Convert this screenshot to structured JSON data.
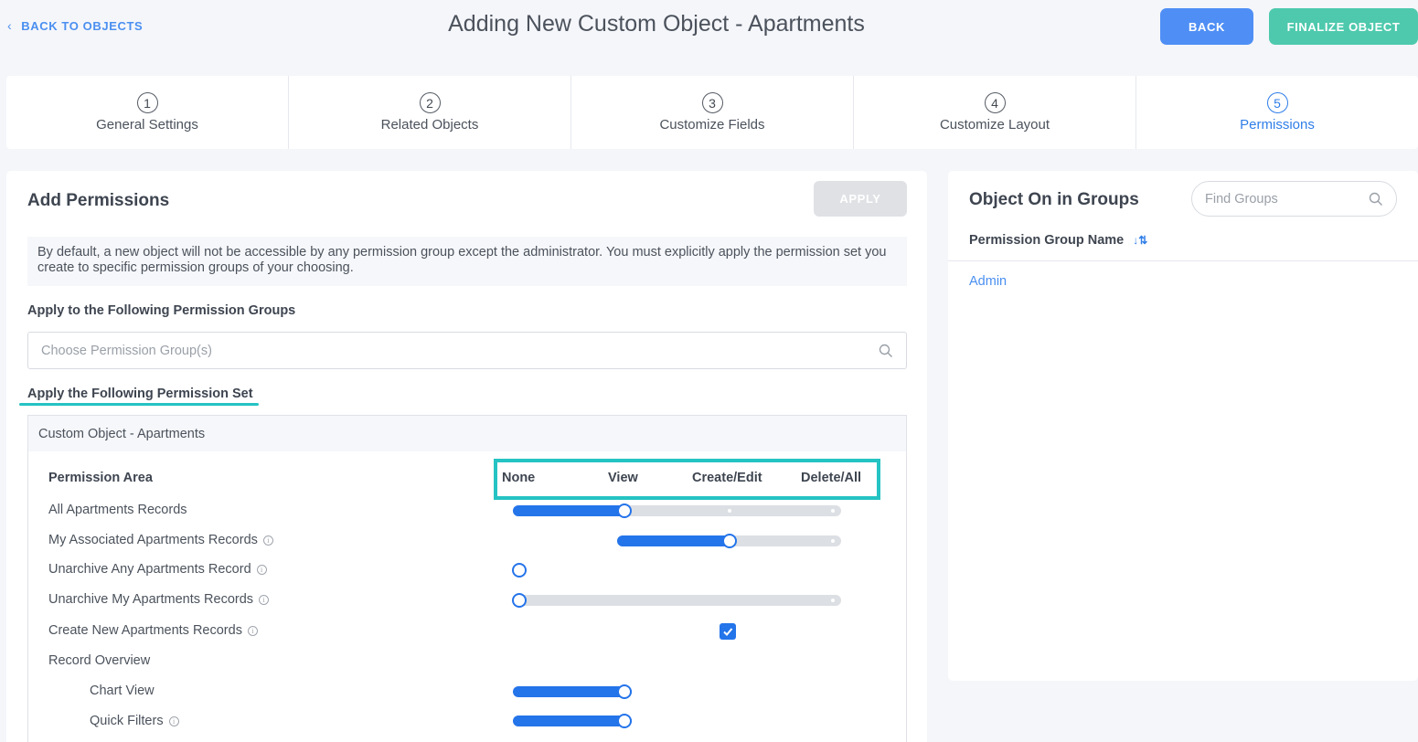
{
  "header": {
    "back_link": "BACK TO OBJECTS",
    "title": "Adding New Custom Object - Apartments",
    "back_button": "BACK",
    "finalize_button": "FINALIZE OBJECT"
  },
  "steps": [
    {
      "num": "1",
      "label": "General Settings"
    },
    {
      "num": "2",
      "label": "Related Objects"
    },
    {
      "num": "3",
      "label": "Customize Fields"
    },
    {
      "num": "4",
      "label": "Customize Layout"
    },
    {
      "num": "5",
      "label": "Permissions",
      "active": true
    }
  ],
  "add_permissions": {
    "title": "Add Permissions",
    "apply_button": "APPLY",
    "info_text": "By default, a new object will not be accessible by any permission group except the administrator. You must explicitly apply the permission set you create to specific permission groups of your choosing.",
    "groups_label": "Apply to the Following Permission Groups",
    "groups_placeholder": "Choose Permission Group(s)",
    "set_label": "Apply the Following Permission Set",
    "set_header": "Custom Object - Apartments",
    "columns": {
      "area": "Permission Area",
      "none": "None",
      "view": "View",
      "create_edit": "Create/Edit",
      "delete_all": "Delete/All"
    },
    "rows": [
      {
        "label": "All Apartments Records",
        "level": "View"
      },
      {
        "label": "My Associated Apartments Records",
        "level": "Create/Edit"
      },
      {
        "label": "Unarchive Any Apartments Record",
        "level": "None"
      },
      {
        "label": "Unarchive My Apartments Records",
        "level": "None"
      },
      {
        "label": "Create New Apartments Records",
        "checked": true
      },
      {
        "label": "Record Overview"
      },
      {
        "label": "Chart View",
        "level": "View"
      },
      {
        "label": "Quick Filters",
        "level": "View"
      }
    ]
  },
  "groups_panel": {
    "title": "Object On in Groups",
    "search_placeholder": "Find Groups",
    "column": "Permission Group Name",
    "groups": [
      "Admin"
    ]
  },
  "colors": {
    "primary": "#2474ea",
    "accent_teal": "#25c3c3",
    "finalize": "#4ec9ad"
  }
}
